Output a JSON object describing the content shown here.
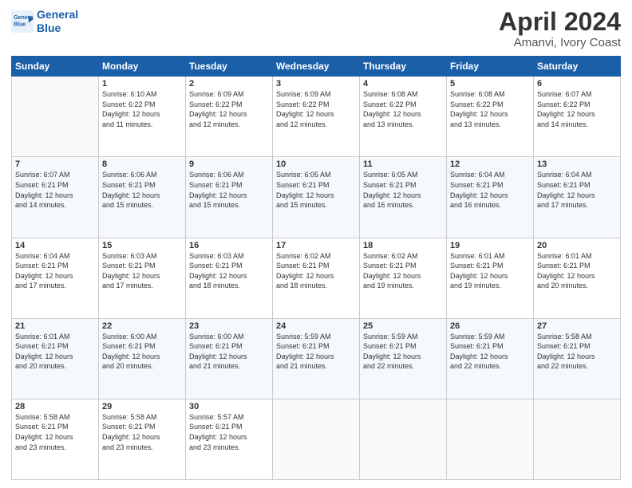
{
  "header": {
    "logo_line1": "General",
    "logo_line2": "Blue",
    "title": "April 2024",
    "subtitle": "Amanvi, Ivory Coast"
  },
  "weekdays": [
    "Sunday",
    "Monday",
    "Tuesday",
    "Wednesday",
    "Thursday",
    "Friday",
    "Saturday"
  ],
  "weeks": [
    [
      {
        "day": "",
        "info": ""
      },
      {
        "day": "1",
        "info": "Sunrise: 6:10 AM\nSunset: 6:22 PM\nDaylight: 12 hours\nand 11 minutes."
      },
      {
        "day": "2",
        "info": "Sunrise: 6:09 AM\nSunset: 6:22 PM\nDaylight: 12 hours\nand 12 minutes."
      },
      {
        "day": "3",
        "info": "Sunrise: 6:09 AM\nSunset: 6:22 PM\nDaylight: 12 hours\nand 12 minutes."
      },
      {
        "day": "4",
        "info": "Sunrise: 6:08 AM\nSunset: 6:22 PM\nDaylight: 12 hours\nand 13 minutes."
      },
      {
        "day": "5",
        "info": "Sunrise: 6:08 AM\nSunset: 6:22 PM\nDaylight: 12 hours\nand 13 minutes."
      },
      {
        "day": "6",
        "info": "Sunrise: 6:07 AM\nSunset: 6:22 PM\nDaylight: 12 hours\nand 14 minutes."
      }
    ],
    [
      {
        "day": "7",
        "info": "Sunrise: 6:07 AM\nSunset: 6:21 PM\nDaylight: 12 hours\nand 14 minutes."
      },
      {
        "day": "8",
        "info": "Sunrise: 6:06 AM\nSunset: 6:21 PM\nDaylight: 12 hours\nand 15 minutes."
      },
      {
        "day": "9",
        "info": "Sunrise: 6:06 AM\nSunset: 6:21 PM\nDaylight: 12 hours\nand 15 minutes."
      },
      {
        "day": "10",
        "info": "Sunrise: 6:05 AM\nSunset: 6:21 PM\nDaylight: 12 hours\nand 15 minutes."
      },
      {
        "day": "11",
        "info": "Sunrise: 6:05 AM\nSunset: 6:21 PM\nDaylight: 12 hours\nand 16 minutes."
      },
      {
        "day": "12",
        "info": "Sunrise: 6:04 AM\nSunset: 6:21 PM\nDaylight: 12 hours\nand 16 minutes."
      },
      {
        "day": "13",
        "info": "Sunrise: 6:04 AM\nSunset: 6:21 PM\nDaylight: 12 hours\nand 17 minutes."
      }
    ],
    [
      {
        "day": "14",
        "info": "Sunrise: 6:04 AM\nSunset: 6:21 PM\nDaylight: 12 hours\nand 17 minutes."
      },
      {
        "day": "15",
        "info": "Sunrise: 6:03 AM\nSunset: 6:21 PM\nDaylight: 12 hours\nand 17 minutes."
      },
      {
        "day": "16",
        "info": "Sunrise: 6:03 AM\nSunset: 6:21 PM\nDaylight: 12 hours\nand 18 minutes."
      },
      {
        "day": "17",
        "info": "Sunrise: 6:02 AM\nSunset: 6:21 PM\nDaylight: 12 hours\nand 18 minutes."
      },
      {
        "day": "18",
        "info": "Sunrise: 6:02 AM\nSunset: 6:21 PM\nDaylight: 12 hours\nand 19 minutes."
      },
      {
        "day": "19",
        "info": "Sunrise: 6:01 AM\nSunset: 6:21 PM\nDaylight: 12 hours\nand 19 minutes."
      },
      {
        "day": "20",
        "info": "Sunrise: 6:01 AM\nSunset: 6:21 PM\nDaylight: 12 hours\nand 20 minutes."
      }
    ],
    [
      {
        "day": "21",
        "info": "Sunrise: 6:01 AM\nSunset: 6:21 PM\nDaylight: 12 hours\nand 20 minutes."
      },
      {
        "day": "22",
        "info": "Sunrise: 6:00 AM\nSunset: 6:21 PM\nDaylight: 12 hours\nand 20 minutes."
      },
      {
        "day": "23",
        "info": "Sunrise: 6:00 AM\nSunset: 6:21 PM\nDaylight: 12 hours\nand 21 minutes."
      },
      {
        "day": "24",
        "info": "Sunrise: 5:59 AM\nSunset: 6:21 PM\nDaylight: 12 hours\nand 21 minutes."
      },
      {
        "day": "25",
        "info": "Sunrise: 5:59 AM\nSunset: 6:21 PM\nDaylight: 12 hours\nand 22 minutes."
      },
      {
        "day": "26",
        "info": "Sunrise: 5:59 AM\nSunset: 6:21 PM\nDaylight: 12 hours\nand 22 minutes."
      },
      {
        "day": "27",
        "info": "Sunrise: 5:58 AM\nSunset: 6:21 PM\nDaylight: 12 hours\nand 22 minutes."
      }
    ],
    [
      {
        "day": "28",
        "info": "Sunrise: 5:58 AM\nSunset: 6:21 PM\nDaylight: 12 hours\nand 23 minutes."
      },
      {
        "day": "29",
        "info": "Sunrise: 5:58 AM\nSunset: 6:21 PM\nDaylight: 12 hours\nand 23 minutes."
      },
      {
        "day": "30",
        "info": "Sunrise: 5:57 AM\nSunset: 6:21 PM\nDaylight: 12 hours\nand 23 minutes."
      },
      {
        "day": "",
        "info": ""
      },
      {
        "day": "",
        "info": ""
      },
      {
        "day": "",
        "info": ""
      },
      {
        "day": "",
        "info": ""
      }
    ]
  ]
}
